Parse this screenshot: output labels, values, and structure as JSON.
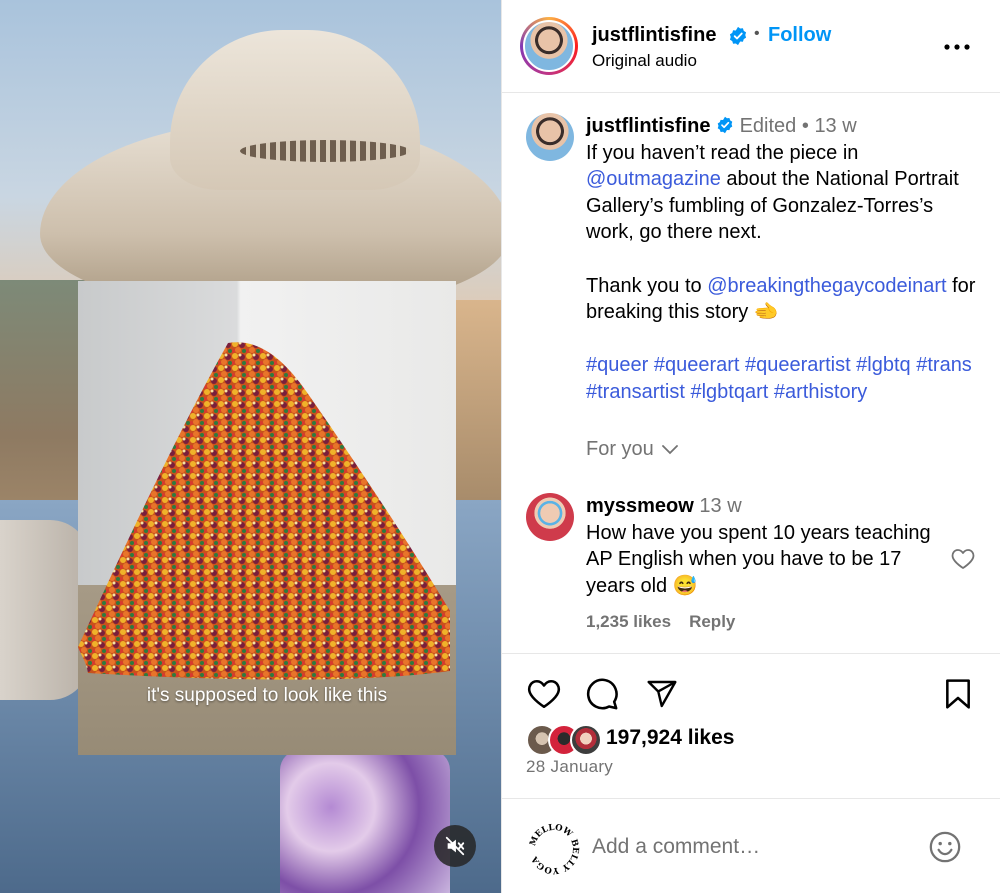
{
  "media": {
    "caption": "it's supposed to look like this",
    "mute_icon": "speaker-muted-icon"
  },
  "header": {
    "username": "justflintisfine",
    "separator": "•",
    "follow_label": "Follow",
    "subtitle": "Original audio",
    "verified_icon": "verified-badge-icon",
    "more_icon": "more-horizontal-icon"
  },
  "caption": {
    "username": "justflintisfine",
    "edited": "Edited",
    "dot": "•",
    "time": "13 w",
    "line1": "If you haven’t read the piece in",
    "mention1": "@outmagazine",
    "line2": " about the National Portrait Gallery’s fumbling of Gonzalez-Torres’s work, go there next.",
    "thanks": "Thank you to ",
    "mention2": "@breakingthegaycodeinart",
    "line3": " for breaking this story ",
    "emoji": "🫲",
    "hashtags": "#queer #queerart #queerartist #lgbtq #trans #transartist #lgbtqart #arthistory"
  },
  "for_you": {
    "label": "For you",
    "icon": "chevron-down-icon"
  },
  "comment": {
    "username": "myssmeow",
    "time": "13 w",
    "text": "How have you spent 10 years teaching AP English when you have to be 17 years old ",
    "emoji": "😅",
    "likes": "1,235 likes",
    "reply_label": "Reply",
    "heart_icon": "heart-outline-icon"
  },
  "actions": {
    "like_icon": "heart-icon",
    "comment_icon": "comment-bubble-icon",
    "share_icon": "paper-plane-icon",
    "save_icon": "bookmark-icon",
    "likes_count": "197,924 likes",
    "date": "28 January"
  },
  "add_comment": {
    "placeholder": "Add a comment…",
    "emoji_icon": "smiley-icon",
    "logo_text": "MELLOW BELLY YOGA"
  },
  "colors": {
    "link": "#3b5bdb",
    "follow": "#0095f6",
    "muted_text": "#737373",
    "verified": "#0095f6"
  }
}
